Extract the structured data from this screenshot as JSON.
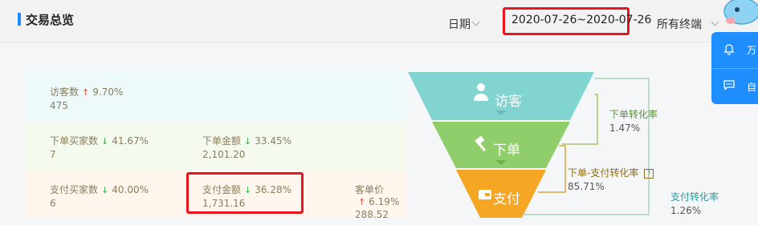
{
  "header": {
    "title": "交易总览",
    "date_label": "日期",
    "date_range": "2020-07-26~2020-07-26",
    "terminal_label": "所有终端"
  },
  "side_panel": {
    "items": [
      {
        "icon": "bell-icon",
        "label": "万"
      },
      {
        "icon": "chat-icon",
        "label": "自"
      }
    ]
  },
  "metrics": {
    "visitors": {
      "label": "访客数",
      "change": "9.70%",
      "direction": "up",
      "value": "475"
    },
    "order_buyers": {
      "label": "下单买家数",
      "change": "41.67%",
      "direction": "down",
      "value": "7"
    },
    "order_amount": {
      "label": "下单金额",
      "change": "33.45%",
      "direction": "down",
      "value": "2,101.20"
    },
    "pay_buyers": {
      "label": "支付买家数",
      "change": "40.00%",
      "direction": "down",
      "value": "6"
    },
    "pay_amount": {
      "label": "支付金额",
      "change": "36.28%",
      "direction": "down",
      "value": "1,731.16"
    },
    "unit_price": {
      "label": "客单价",
      "change": "6.19%",
      "direction": "up",
      "value": "288.52"
    }
  },
  "funnel": {
    "stages": [
      {
        "label": "访客",
        "icon": "person-icon",
        "color": "#82d4d1"
      },
      {
        "label": "下单",
        "icon": "hammer-icon",
        "color": "#8fce6a"
      },
      {
        "label": "支付",
        "icon": "wallet-icon",
        "color": "#f5a623"
      }
    ]
  },
  "conversion": {
    "order_rate": {
      "label": "下单转化率",
      "value": "1.47%",
      "color": "#5a8f3c"
    },
    "order_pay_rate": {
      "label": "下单-支付转化率",
      "value": "85.71%",
      "color": "#8a6d1e"
    },
    "pay_rate": {
      "label": "支付转化率",
      "value": "1.26%",
      "color": "#2a9c9c"
    }
  }
}
